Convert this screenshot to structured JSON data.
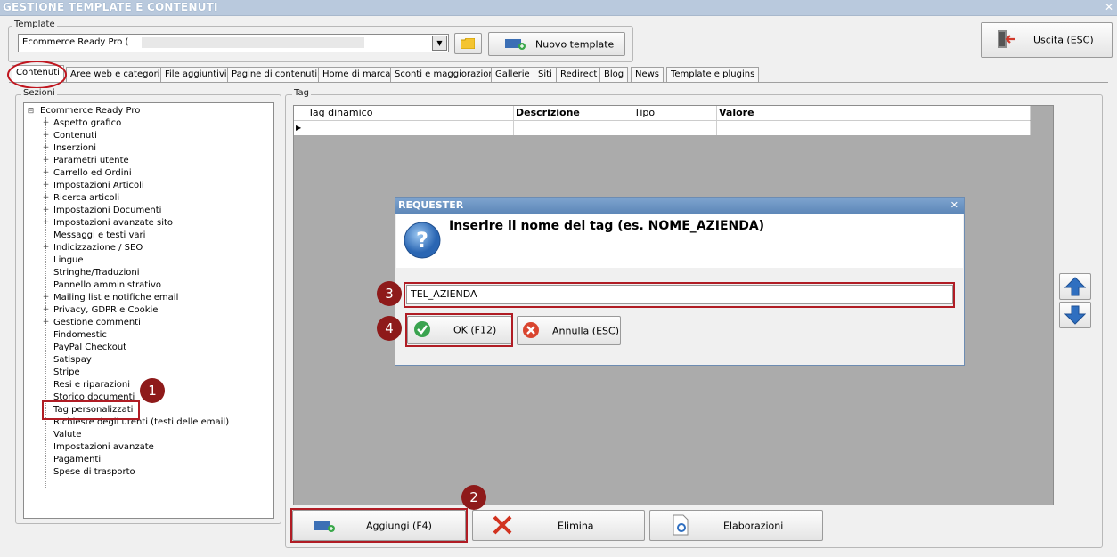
{
  "window": {
    "title": "GESTIONE TEMPLATE E CONTENUTI",
    "close": "✕"
  },
  "template_group": {
    "legend": "Template",
    "selected": "Ecommerce Ready Pro (",
    "new_button": "Nuovo template"
  },
  "exit_button": "Uscita (ESC)",
  "tabs": [
    "Contenuti",
    "Aree web e categorie",
    "File aggiuntivi",
    "Pagine di contenuti",
    "Home di marca",
    "Sconti e maggiorazioni",
    "Gallerie",
    "Siti",
    "Redirect",
    "Blog",
    "News",
    "Template e plugins"
  ],
  "sections": {
    "legend": "Sezioni",
    "root": "Ecommerce Ready Pro",
    "items": [
      {
        "label": "Aspetto grafico",
        "expandable": true
      },
      {
        "label": "Contenuti",
        "expandable": true
      },
      {
        "label": "Inserzioni",
        "expandable": true
      },
      {
        "label": "Parametri utente",
        "expandable": true
      },
      {
        "label": "Carrello ed Ordini",
        "expandable": true
      },
      {
        "label": "Impostazioni Articoli",
        "expandable": true
      },
      {
        "label": "Ricerca articoli",
        "expandable": true
      },
      {
        "label": "Impostazioni Documenti",
        "expandable": true
      },
      {
        "label": "Impostazioni avanzate sito",
        "expandable": true
      },
      {
        "label": "Messaggi e testi vari",
        "expandable": false
      },
      {
        "label": "Indicizzazione / SEO",
        "expandable": true
      },
      {
        "label": "Lingue",
        "expandable": false
      },
      {
        "label": "Stringhe/Traduzioni",
        "expandable": false
      },
      {
        "label": "Pannello amministrativo",
        "expandable": false
      },
      {
        "label": "Mailing list e notifiche email",
        "expandable": true
      },
      {
        "label": "Privacy, GDPR e Cookie",
        "expandable": true
      },
      {
        "label": "Gestione commenti",
        "expandable": true
      },
      {
        "label": "Findomestic",
        "expandable": false
      },
      {
        "label": "PayPal Checkout",
        "expandable": false
      },
      {
        "label": "Satispay",
        "expandable": false
      },
      {
        "label": "Stripe",
        "expandable": false
      },
      {
        "label": "Resi e riparazioni",
        "expandable": false
      },
      {
        "label": "Storico documenti",
        "expandable": false
      },
      {
        "label": "Tag personalizzati",
        "expandable": false
      },
      {
        "label": "Richieste degli utenti (testi delle email)",
        "expandable": false
      },
      {
        "label": "Valute",
        "expandable": false
      },
      {
        "label": "Impostazioni avanzate",
        "expandable": false
      },
      {
        "label": "Pagamenti",
        "expandable": false
      },
      {
        "label": "Spese di trasporto",
        "expandable": false
      }
    ]
  },
  "tag_group": {
    "legend": "Tag",
    "columns": [
      "Tag dinamico",
      "Descrizione",
      "Tipo",
      "Valore"
    ]
  },
  "buttons": {
    "add": "Aggiungi (F4)",
    "delete": "Elimina",
    "process": "Elaborazioni"
  },
  "dialog": {
    "title": "REQUESTER",
    "close": "✕",
    "message": "Inserire il nome del tag (es. NOME_AZIENDA)",
    "input_value": "TEL_AZIENDA",
    "ok": "OK (F12)",
    "cancel": "Annulla (ESC)"
  },
  "badges": [
    "1",
    "2",
    "3",
    "4"
  ],
  "colors": {
    "title_bar": "#b9c9dd",
    "dialog_title": "#5d87b8",
    "highlight": "#b01c24",
    "badge": "#8e1a1a",
    "grid_bg": "#ababab"
  }
}
